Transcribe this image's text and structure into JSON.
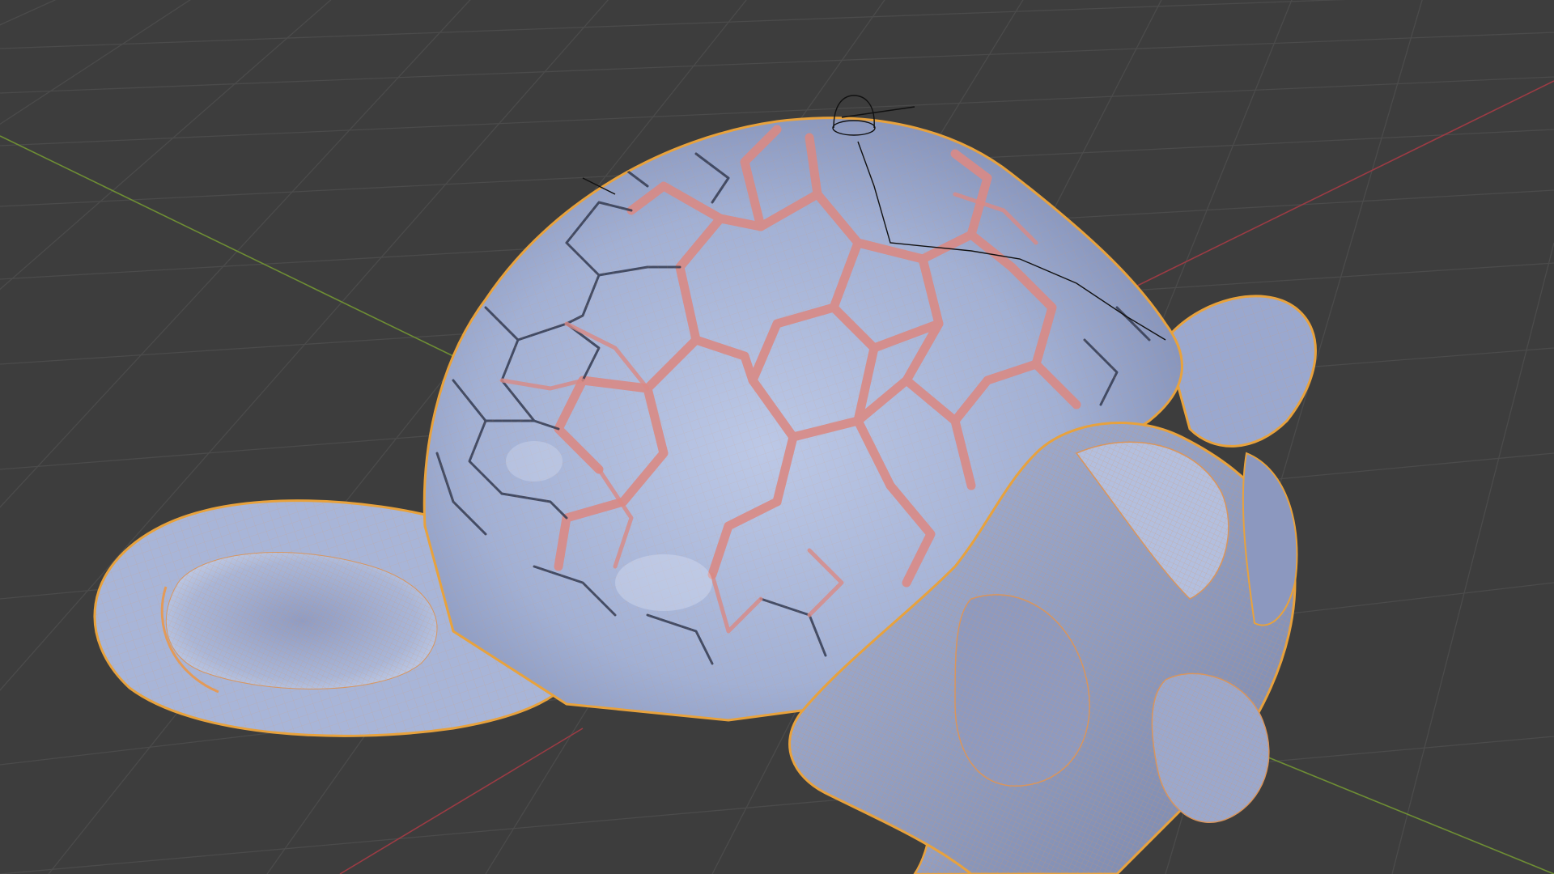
{
  "viewport": {
    "view_type": "3d-viewport",
    "object_name": "",
    "shading": "solid",
    "overlays": [
      "floor-grid",
      "x-axis-line",
      "y-axis-line",
      "wireframe",
      "object-outline",
      "object-origin"
    ]
  },
  "colors": {
    "background": "#3d3d3d",
    "grid_line": "#4a4a4a",
    "x_axis": "#9c3b44",
    "y_axis": "#6e8e34",
    "mesh_fill": "#a6b4d6",
    "mesh_shadow": "#7f8cb0",
    "crack_fill": "#d98a86",
    "crack_edge": "#3a3f55",
    "wire": "#d9955c",
    "outline": "#e8a23c",
    "origin": "#111111"
  }
}
